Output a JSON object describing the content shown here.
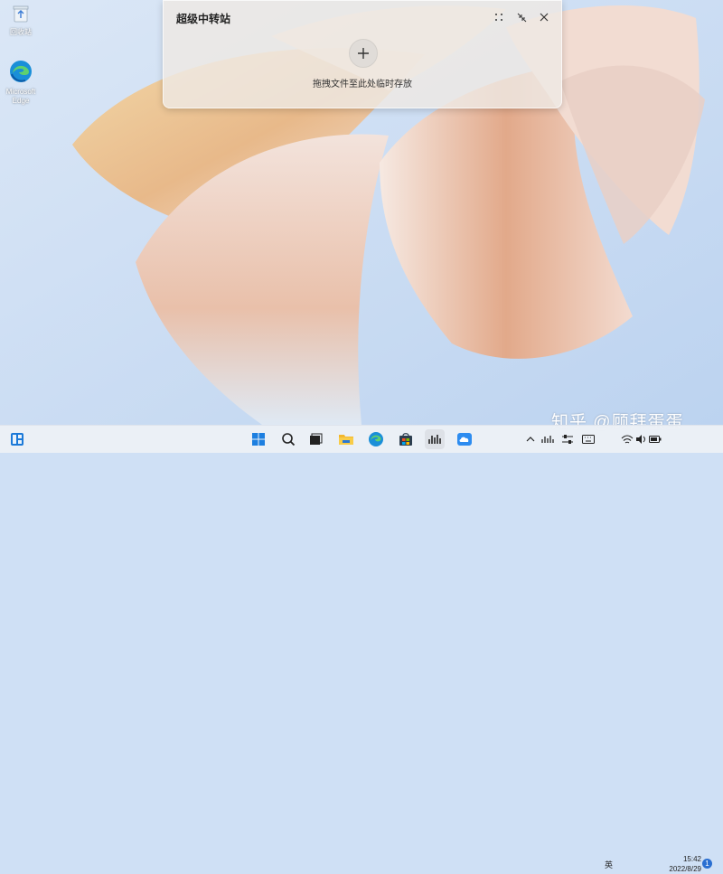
{
  "desktop": {
    "icons": [
      {
        "label": "回收站",
        "icon": "recycle-bin-icon"
      },
      {
        "label": "Microsoft Edge",
        "icon": "edge-icon"
      }
    ]
  },
  "panel": {
    "title": "超级中转站",
    "drop_hint": "拖拽文件至此处临时存放",
    "buttons": [
      "drag-handle-icon",
      "collapse-icon",
      "close-icon"
    ]
  },
  "taskbar": {
    "left_icon": "widgets-icon",
    "apps": [
      "start-icon",
      "search-icon",
      "task-view-icon",
      "file-explorer-icon",
      "edge-icon",
      "store-icon",
      "audio-app-icon",
      "cloud-icon"
    ]
  },
  "tray": {
    "ime": "英",
    "time": "15:42",
    "date": "2022/8/29",
    "notification_count": "1"
  },
  "watermark": "知乎 @顾拜蛋蛋"
}
